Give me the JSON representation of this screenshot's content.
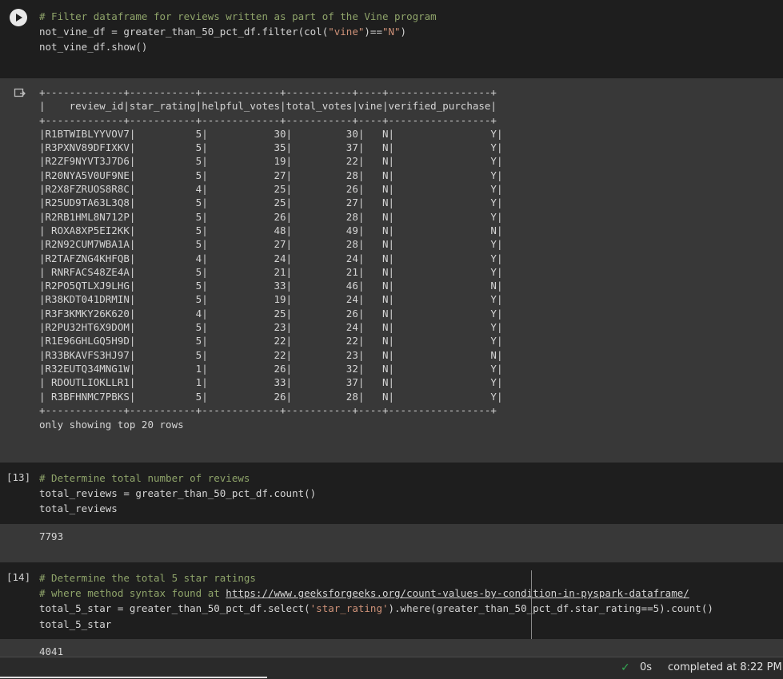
{
  "cell1": {
    "lines": [
      "# Filter dataframe for reviews written as part of the Vine program",
      "not_vine_df = greater_than_50_pct_df.filter(col(\"vine\")==\"N\")",
      "not_vine_df.show()"
    ],
    "output": {
      "table": [
        "+-------------+-----------+-------------+-----------+----+-----------------+",
        "|    review_id|star_rating|helpful_votes|total_votes|vine|verified_purchase|",
        "+-------------+-----------+-------------+-----------+----+-----------------+",
        "|R1BTWIBLYYVOV7|          5|           30|         30|   N|                Y|",
        "|R3PXNV89DFIXKV|          5|           35|         37|   N|                Y|",
        "|R2ZF9NYVT3J7D6|          5|           19|         22|   N|                Y|",
        "|R20NYA5V0UF9NE|          5|           27|         28|   N|                Y|",
        "|R2X8FZRUOS8R8C|          4|           25|         26|   N|                Y|",
        "|R25UD9TA63L3Q8|          5|           25|         27|   N|                Y|",
        "|R2RB1HML8N712P|          5|           26|         28|   N|                Y|",
        "| ROXA8XP5EI2KK|          5|           48|         49|   N|                N|",
        "|R2N92CUM7WBA1A|          5|           27|         28|   N|                Y|",
        "|R2TAFZNG4KHFQB|          4|           24|         24|   N|                Y|",
        "| RNRFACS48ZE4A|          5|           21|         21|   N|                Y|",
        "|R2PO5QTLXJ9LHG|          5|           33|         46|   N|                N|",
        "|R38KDT041DRMIN|          5|           19|         24|   N|                Y|",
        "|R3F3KMKY26K620|          4|           25|         26|   N|                Y|",
        "|R2PU32HT6X9DOM|          5|           23|         24|   N|                Y|",
        "|R1E96GHLGQ5H9D|          5|           22|         22|   N|                Y|",
        "|R33BKAVFS3HJ97|          5|           22|         23|   N|                N|",
        "|R32EUTQ34MNG1W|          1|           26|         32|   N|                Y|",
        "| RDOUTLIOKLLR1|          1|           33|         37|   N|                Y|",
        "| R3BFHNMC7PBKS|          5|           26|         28|   N|                Y|",
        "+-------------+-----------+-------------+-----------+----+-----------------+"
      ],
      "footer": "only showing top 20 rows"
    }
  },
  "cell2": {
    "exec_count": "[13]",
    "lines": [
      "# Determine total number of reviews",
      "total_reviews = greater_than_50_pct_df.count()",
      "total_reviews"
    ],
    "output": "7793"
  },
  "cell3": {
    "exec_count": "[14]",
    "comment1": "# Determine the total 5 star ratings",
    "comment2_prefix": "# where method syntax found at ",
    "comment2_url": "https://www.geeksforgeeks.org/count-values-by-condition-in-pyspark-dataframe/",
    "line3_a": "total_5_star = greater_than_50_pct_df.select(",
    "line3_str": "'star_rating'",
    "line3_b": ").where(greater_than_50_pct_df.star_rating==5).count()",
    "line4": "total_5_star",
    "output": "4041"
  },
  "status": {
    "check_icon": "check-icon",
    "time": "0s",
    "completed": "completed at 8:22 PM"
  }
}
